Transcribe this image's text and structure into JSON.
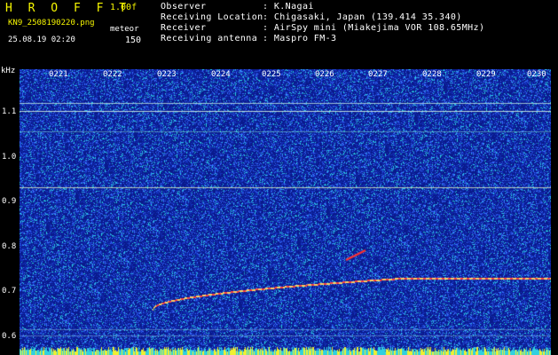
{
  "header": {
    "app_title": "H R O F F T",
    "app_version": "1.00f",
    "file_name": "KN9_2508190220.png",
    "mode_label": "meteor",
    "timestamp": "25.08.19 02:20",
    "mode_value": "150",
    "meta": [
      {
        "label": "Observer",
        "value": ": K.Nagai"
      },
      {
        "label": "Receiving Location",
        "value": ": Chigasaki, Japan (139.414 35.340)"
      },
      {
        "label": "Receiver",
        "value": ": AirSpy mini (Miakejima VOR 108.65MHz)"
      },
      {
        "label": "Receiving antenna",
        "value": ": Maspro FM-3"
      }
    ]
  },
  "axis": {
    "unit": "kHz",
    "y_ticks": [
      "1.1",
      "1.0",
      "0.9",
      "0.8",
      "0.7",
      "0.6"
    ],
    "x_ticks": [
      "0221",
      "0222",
      "0223",
      "0224",
      "0225",
      "0226",
      "0227",
      "0228",
      "0229",
      "0230"
    ]
  },
  "colors": {
    "background": "#000000",
    "waterfall_base": "#0a1a8c",
    "noise_cyan": "#2fd0e0",
    "noise_blue": "#3a6cff",
    "trace_red": "#ff3030",
    "header_yellow": "#f7f700"
  }
}
